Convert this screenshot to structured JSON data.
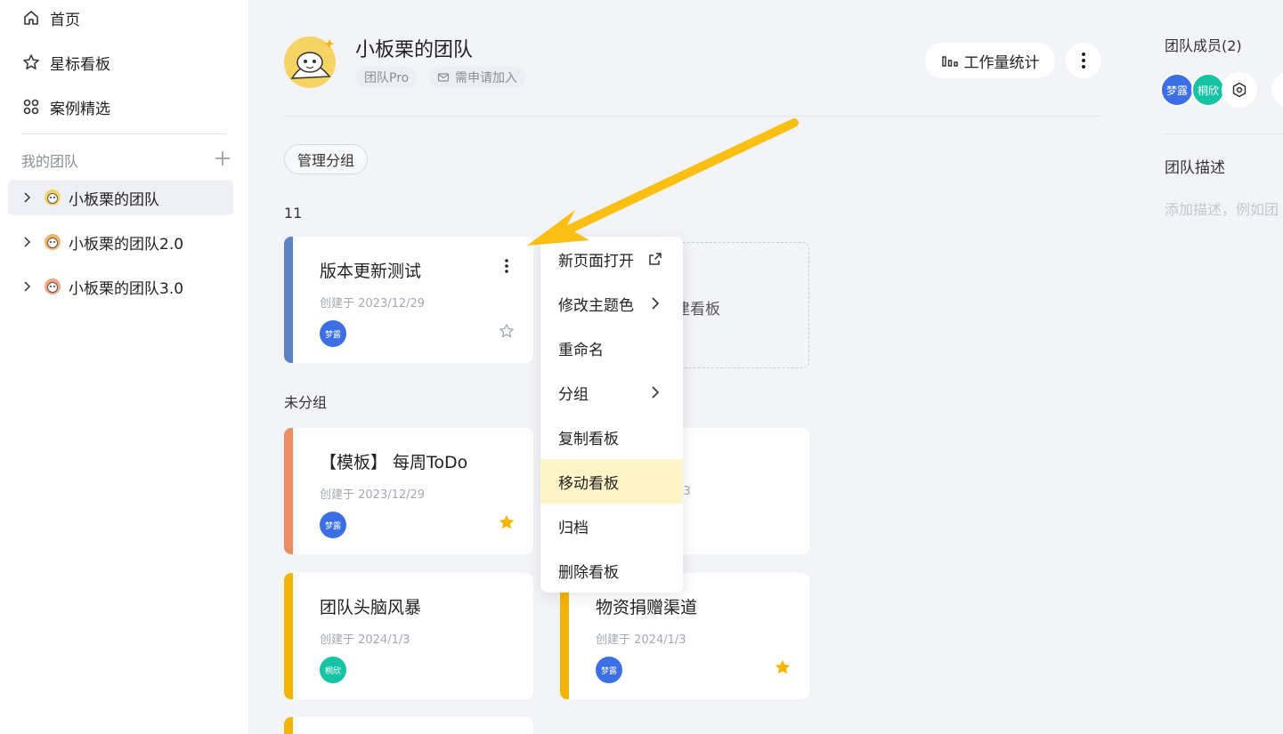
{
  "sidebar": {
    "nav": [
      {
        "label": "首页",
        "icon": "home-icon"
      },
      {
        "label": "星标看板",
        "icon": "star-icon"
      },
      {
        "label": "案例精选",
        "icon": "grid-icon"
      }
    ],
    "my_teams_label": "我的团队",
    "teams": [
      {
        "name": "小板栗的团队",
        "active": true
      },
      {
        "name": "小板栗的团队2.0",
        "active": false
      },
      {
        "name": "小板栗的团队3.0",
        "active": false
      }
    ]
  },
  "header": {
    "team_name": "小板栗的团队",
    "tag_plan": "团队Pro",
    "tag_join": "需申请加入",
    "stats_button": "工作量统计"
  },
  "toolbar": {
    "manage_groups": "管理分组"
  },
  "groups": [
    {
      "name": "11",
      "boards": [
        {
          "title": "版本更新测试",
          "date": "创建于 2023/12/29",
          "owner": "梦露",
          "starred": false,
          "accent": "#5b82c6"
        }
      ],
      "new_board_label": "建看板"
    },
    {
      "name": "未分组",
      "boards": [
        {
          "title": "【模板】 每周ToDo",
          "date": "创建于 2023/12/29",
          "owner": "梦露",
          "starred": true,
          "accent": "#ee8b60"
        },
        {
          "title": "",
          "date": "/3",
          "owner": "",
          "starred": false,
          "accent": "#f5b400"
        },
        {
          "title": "团队头脑风暴",
          "date": "创建于 2024/1/3",
          "owner": "桐欣",
          "starred": false,
          "accent": "#f5b400"
        },
        {
          "title": "物资捐赠渠道",
          "date": "创建于 2024/1/3",
          "owner": "梦露",
          "starred": true,
          "accent": "#f5b400"
        }
      ]
    }
  ],
  "context_menu": {
    "items": [
      {
        "label": "新页面打开",
        "icon": "external-link-icon"
      },
      {
        "label": "修改主题色",
        "icon": "chevron-right-icon"
      },
      {
        "label": "重命名",
        "icon": ""
      },
      {
        "label": "分组",
        "icon": "chevron-right-icon"
      },
      {
        "label": "复制看板",
        "icon": ""
      },
      {
        "label": "移动看板",
        "icon": "",
        "highlighted": true
      },
      {
        "label": "归档",
        "icon": ""
      },
      {
        "label": "删除看板",
        "icon": ""
      }
    ]
  },
  "right_panel": {
    "members_label": "团队成员(2)",
    "members": [
      {
        "name": "梦露",
        "color": "#3c6fe6"
      },
      {
        "name": "桐欣",
        "color": "#17c3a5"
      }
    ],
    "description_label": "团队描述",
    "description_placeholder": "添加描述，例如团"
  },
  "colors": {
    "accent_yellow": "#f5b400",
    "avatar_blue": "#3c6fe6",
    "avatar_teal": "#17c3a5",
    "highlight": "#fff4c8",
    "annotation_arrow": "#fbbf14"
  }
}
